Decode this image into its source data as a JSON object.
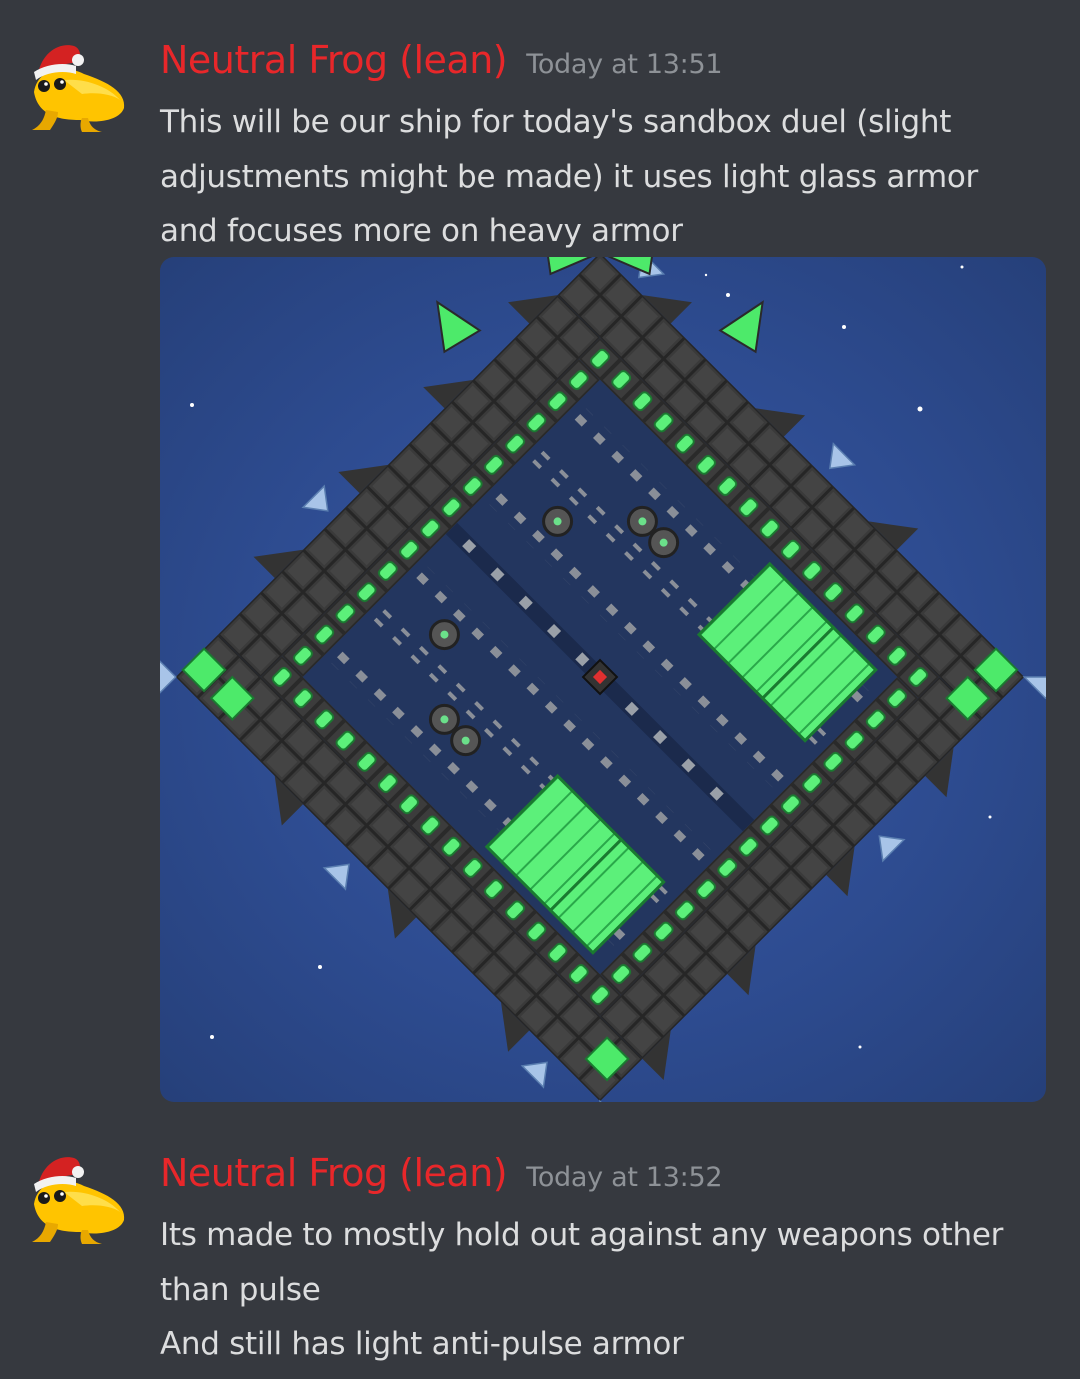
{
  "messages": [
    {
      "author": "Neutral Frog (lean)",
      "timestamp": "Today at 13:51",
      "avatar_icon": "frog-santa-hat-avatar",
      "text": "This will be our ship for today's sandbox duel (slight adjustments might be made) it uses light glass armor and focuses more on heavy armor",
      "attachment": "ship-screenshot-image"
    },
    {
      "author": "Neutral Frog (lean)",
      "timestamp": "Today at 13:52",
      "avatar_icon": "frog-santa-hat-avatar",
      "lines": [
        "Its made to mostly hold out against any weapons other than pulse",
        "And still has light anti-pulse armor"
      ]
    }
  ],
  "colors": {
    "background": "#36393f",
    "author": "#e8272a",
    "timestamp": "#8e9297",
    "text": "#dcddde"
  }
}
